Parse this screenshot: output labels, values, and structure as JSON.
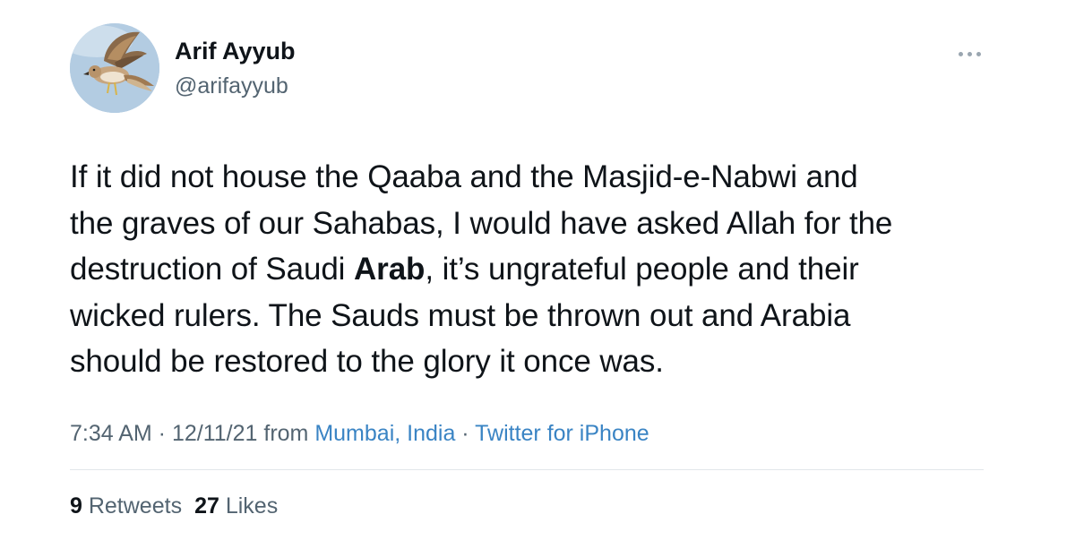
{
  "user": {
    "display_name": "Arif Ayyub",
    "handle": "@arifayyub",
    "avatar_icon": "hawk-avatar"
  },
  "more_icon": "ellipsis-icon",
  "tweet": {
    "line1": "If it did not house the Qaaba and the Masjid-e-Nabwi and",
    "line2": "the graves of our Sahabas, I would have asked Allah for the",
    "line3_pre": "destruction of Saudi ",
    "line3_bold": "Arab",
    "line3_post": ", it’s ungrateful people and their",
    "line4": "wicked rulers. The Sauds must be thrown out and Arabia",
    "line5": "should be restored to the glory it once was."
  },
  "meta": {
    "time": "7:34 AM",
    "sep1": " · ",
    "date": "12/11/21",
    "from": " from ",
    "location": "Mumbai, India",
    "sep2": " · ",
    "source": "Twitter for iPhone"
  },
  "stats": {
    "retweets_count": "9",
    "retweets_label": " Retweets",
    "likes_count": "27",
    "likes_label": " Likes"
  },
  "colors": {
    "text": "#0f1419",
    "secondary": "#536471",
    "link": "#3a84c4",
    "divider": "#e2e6ea"
  }
}
